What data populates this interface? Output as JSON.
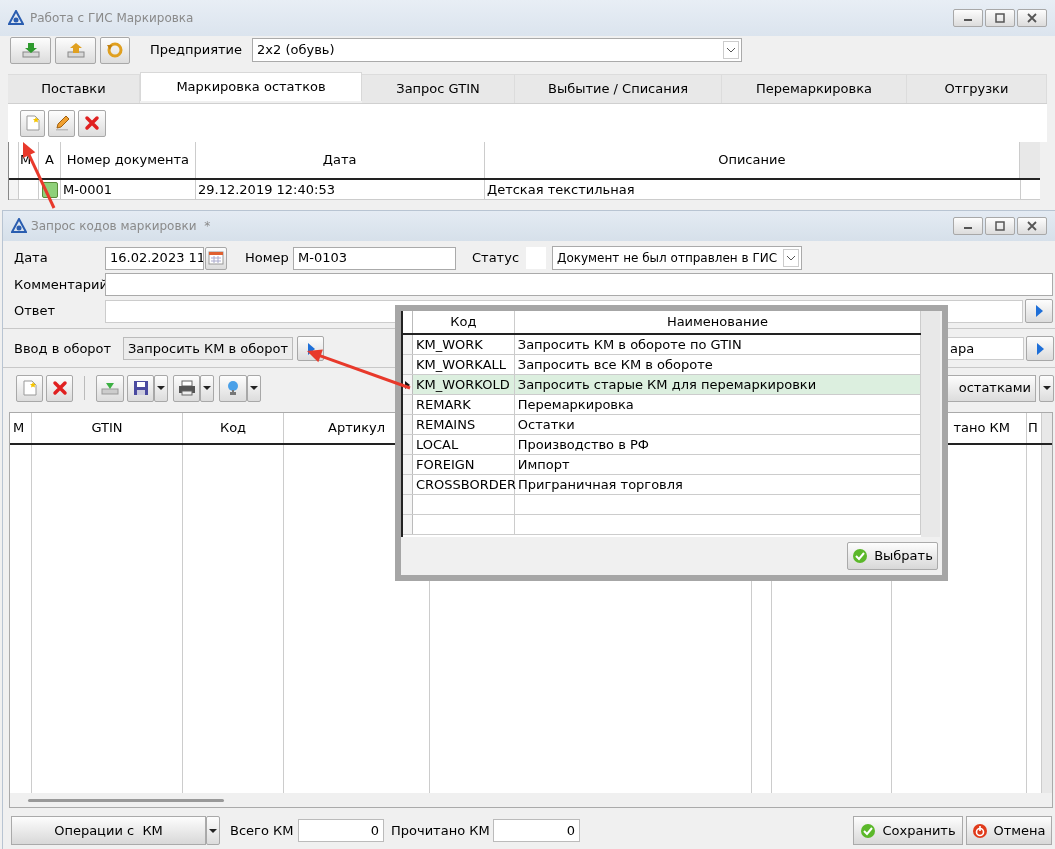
{
  "main_window": {
    "title": "Работа с ГИС Маркировка",
    "enterprise_label": "Предприятие",
    "enterprise_value": "2x2 (обувь)",
    "tabs": [
      {
        "label": "Поставки",
        "selected": false
      },
      {
        "label": "Маркировка остатков",
        "selected": true
      },
      {
        "label": "Запрос GTIN",
        "selected": false
      },
      {
        "label": "Выбытие / Списания",
        "selected": false
      },
      {
        "label": "Перемаркировка",
        "selected": false
      },
      {
        "label": "Отгрузки",
        "selected": false
      }
    ],
    "grid": {
      "columns": [
        "М",
        "А",
        "Номер документа",
        "Дата",
        "Описание"
      ],
      "rows": [
        {
          "number": "M-0001",
          "date": "29.12.2019 12:40:53",
          "description": "Детская текстильная",
          "active": true
        }
      ]
    }
  },
  "dialog": {
    "title": "Запрос кодов маркировки  *",
    "date_label": "Дата",
    "date_value": "16.02.2023 11",
    "number_label": "Номер",
    "number_value": "M-0103",
    "status_label": "Статус",
    "status_value": "Документ не был отправлен в ГИС",
    "comment_label": "Комментарий",
    "answer_label": "Ответ",
    "entry_label": "Ввод в оборот",
    "entry_button": "Запросить КМ в оборот",
    "right_field": "ара",
    "right_button": "остатками",
    "grid_columns": [
      "М",
      "GTIN",
      "Код",
      "Артикул",
      "тано КМ",
      "П"
    ],
    "operations_button": "Операции с  КМ",
    "total_label": "Всего КМ",
    "total_value": "0",
    "read_label": "Прочитано КМ",
    "read_value": "0",
    "save_button": "Сохранить",
    "cancel_button": "Отмена"
  },
  "picker": {
    "columns": [
      "Код",
      "Наименование"
    ],
    "rows": [
      {
        "code": "KM_WORK",
        "name": "Запросить КМ в обороте по GTIN",
        "selected": false
      },
      {
        "code": "KM_WORKALL",
        "name": "Запросить все КМ в обороте",
        "selected": false
      },
      {
        "code": "KM_WORKOLD",
        "name": "Запросить старые КМ для перемаркировки",
        "selected": true
      },
      {
        "code": "REMARK",
        "name": "Перемаркировка",
        "selected": false
      },
      {
        "code": "REMAINS",
        "name": "Остатки",
        "selected": false
      },
      {
        "code": "LOCAL",
        "name": "Производство в РФ",
        "selected": false
      },
      {
        "code": "FOREIGN",
        "name": "Импорт",
        "selected": false
      },
      {
        "code": "CROSSBORDER",
        "name": "Приграничная торговля",
        "selected": false
      }
    ],
    "button": "Выбрать"
  }
}
